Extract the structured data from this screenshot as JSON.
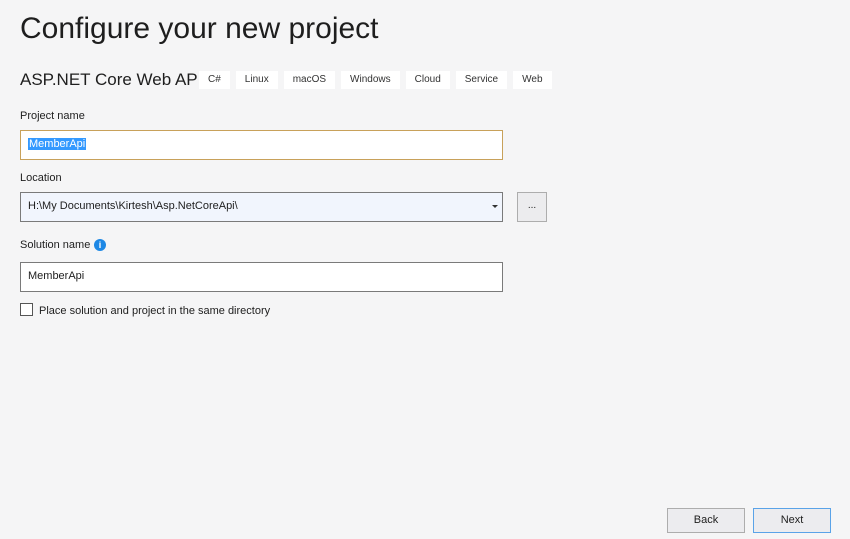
{
  "title": "Configure your new project",
  "template": {
    "name": "ASP.NET Core Web API",
    "tags": [
      "C#",
      "Linux",
      "macOS",
      "Windows",
      "Cloud",
      "Service",
      "Web"
    ]
  },
  "project_name": {
    "label": "Project name",
    "value": "MemberApi"
  },
  "location": {
    "label": "Location",
    "value": "H:\\My Documents\\Kirtesh\\Asp.NetCoreApi\\",
    "browse_label": "..."
  },
  "solution_name": {
    "label": "Solution name",
    "value": "MemberApi",
    "info_icon": "i"
  },
  "same_directory": {
    "label": "Place solution and project in the same directory",
    "checked": false
  },
  "buttons": {
    "back": "Back",
    "next": "Next"
  }
}
